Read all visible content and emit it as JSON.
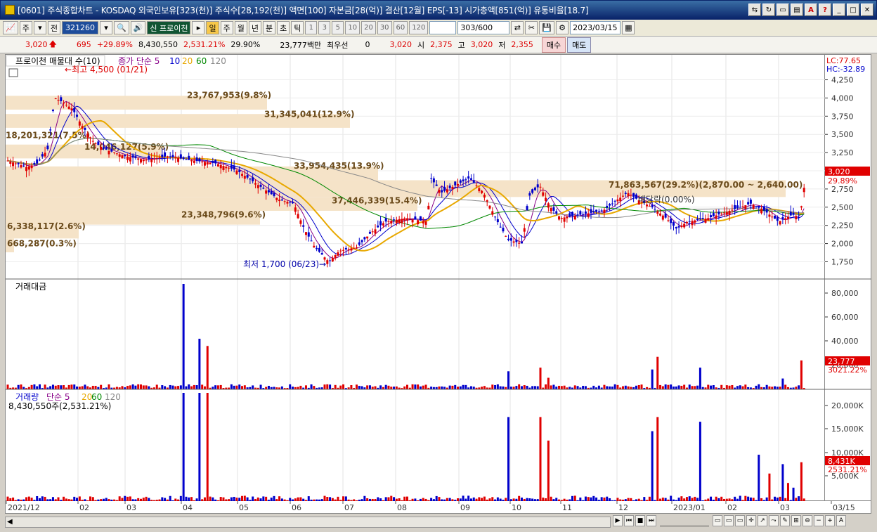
{
  "window": {
    "title": "[0601] 주식종합차트 - KOSDAQ 외국인보유[323(천)] 주식수[28,192(천)] 액면[100] 자본금[28(억)] 결산[12월] EPS[-13] 시가총액[851(억)] 유통비율[18.7]"
  },
  "toolbar": {
    "market_select": "주",
    "prev_label": "전",
    "code": "321260",
    "program_label": "신 프로이천",
    "periods": [
      "일",
      "주",
      "월",
      "년",
      "분",
      "초",
      "틱"
    ],
    "active_period": "일",
    "numbers": [
      "1",
      "3",
      "5",
      "10",
      "20",
      "30",
      "60",
      "120"
    ],
    "count": "303",
    "count_total": "/600",
    "date": "2023/03/15"
  },
  "quote": {
    "price": "3,020",
    "change": "695",
    "change_pct": "+29.89%",
    "volume": "8,430,550",
    "volume_pct": "2,531.21%",
    "turnover": "29.90%",
    "amount": "23,777백만",
    "pref_label": "최우선",
    "pref_value": "0",
    "ask": "3,020",
    "open_label": "시",
    "open": "2,375",
    "high_label": "고",
    "high": "3,020",
    "low_label": "저",
    "low": "2,355",
    "buy": "매수",
    "sell": "매도"
  },
  "price_panel": {
    "legend_title": "프로이천 매물대 수(10)",
    "ma_label": "종가 단순 5",
    "ma_periods": [
      "10",
      "20",
      "60",
      "120"
    ],
    "high_note": "최고 4,500 (01/21)",
    "low_note": "최저 1,700 (06/23)",
    "lc": "LC:77.65",
    "hc": "HC:-32.89",
    "current_price": "3,020",
    "current_pct": "29.89%",
    "dividend": "배당락(0.00%)",
    "volume_profile_labels": [
      "23,767,953(9.8%)",
      "31,345,041(12.9%)",
      "14,046,127(5.9%)",
      "33,954,435(13.9%)",
      "71,863,567(29.2%)(2,870.00 ~ 2,640.00)",
      "37,446,339(15.4%)",
      "23,348,796(9.6%)",
      "6,338,117(2.6%)",
      "668,287(0.3%)",
      "18,201,321(7.5%)"
    ],
    "y_ticks": [
      "4,250",
      "4,000",
      "3,750",
      "3,500",
      "3,250",
      "3,000",
      "2,750",
      "2,500",
      "2,250",
      "2,000",
      "1,750"
    ]
  },
  "amount_panel": {
    "title": "거래대금",
    "y_ticks": [
      "80,000",
      "60,000",
      "40,000",
      "20,000"
    ],
    "current": "23,777",
    "current_pct": "3021.22%"
  },
  "volume_panel": {
    "title": "거래량",
    "ma_label": "단순 5",
    "ma_periods": [
      "20",
      "60",
      "120"
    ],
    "value_note": "8,430,550주(2,531.21%)",
    "y_ticks": [
      "20,000K",
      "15,000K",
      "10,000K",
      "5,000K"
    ],
    "current": "8,431K",
    "current_pct": "2531.21%"
  },
  "x_axis": [
    "2021/12",
    "02",
    "03",
    "04",
    "05",
    "06",
    "07",
    "08",
    "09",
    "10",
    "11",
    "12",
    "2023/01",
    "02",
    "03",
    "03/15"
  ],
  "colors": {
    "up": "#e00000",
    "down": "#0000cc",
    "ma5": "#880088",
    "ma10": "#0000cc",
    "ma20": "#e8a800",
    "ma60": "#008800",
    "ma120": "#888888",
    "profile": "#f5e3c8"
  }
}
